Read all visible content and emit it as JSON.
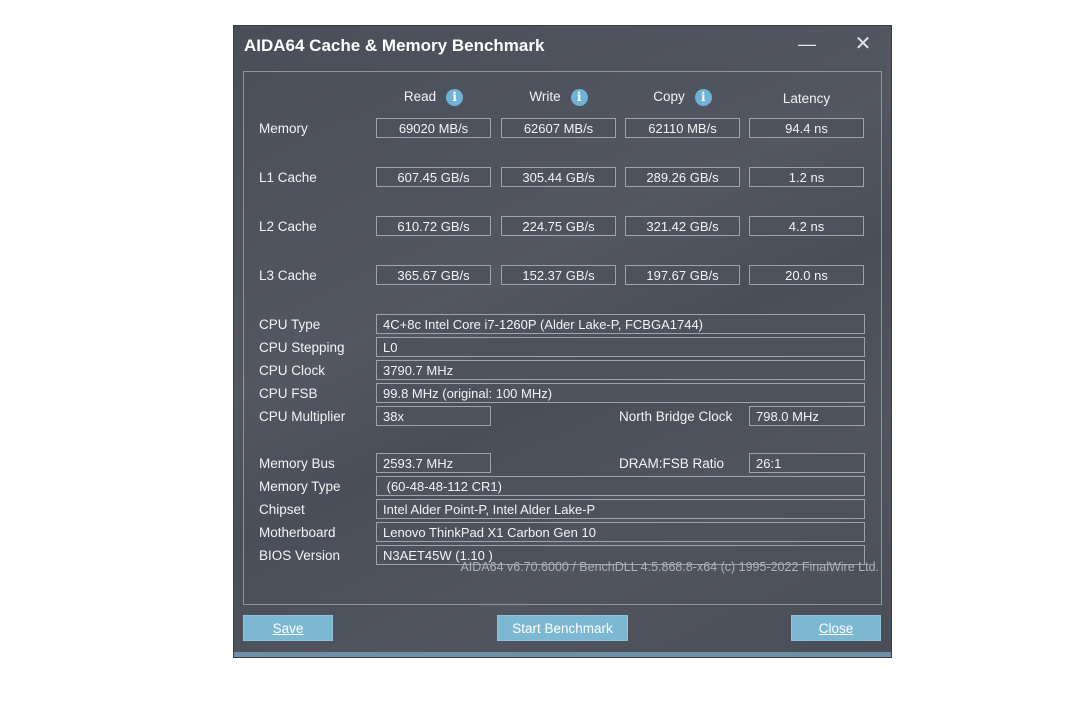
{
  "window": {
    "title": "AIDA64 Cache & Memory Benchmark",
    "minimize_glyph": "—",
    "close_glyph": "✕"
  },
  "columns": {
    "read": "Read",
    "write": "Write",
    "copy": "Copy",
    "latency": "Latency",
    "info_glyph": "i"
  },
  "bench": [
    {
      "label": "Memory",
      "read": "69020 MB/s",
      "write": "62607 MB/s",
      "copy": "62110 MB/s",
      "latency": "94.4 ns"
    },
    {
      "label": "L1 Cache",
      "read": "607.45 GB/s",
      "write": "305.44 GB/s",
      "copy": "289.26 GB/s",
      "latency": "1.2 ns"
    },
    {
      "label": "L2 Cache",
      "read": "610.72 GB/s",
      "write": "224.75 GB/s",
      "copy": "321.42 GB/s",
      "latency": "4.2 ns"
    },
    {
      "label": "L3 Cache",
      "read": "365.67 GB/s",
      "write": "152.37 GB/s",
      "copy": "197.67 GB/s",
      "latency": "20.0 ns"
    }
  ],
  "cpu": {
    "type_label": "CPU Type",
    "type_value": "4C+8c Intel Core i7-1260P  (Alder Lake-P, FCBGA1744)",
    "stepping_label": "CPU Stepping",
    "stepping_value": "L0",
    "clock_label": "CPU Clock",
    "clock_value": "3790.7 MHz",
    "fsb_label": "CPU FSB",
    "fsb_value": "99.8 MHz  (original: 100 MHz)",
    "multiplier_label": "CPU Multiplier",
    "multiplier_value": "38x",
    "nb_clock_label": "North Bridge Clock",
    "nb_clock_value": "798.0 MHz"
  },
  "memory": {
    "bus_label": "Memory Bus",
    "bus_value": "2593.7 MHz",
    "ratio_label": "DRAM:FSB Ratio",
    "ratio_value": "26:1",
    "type_label": "Memory Type",
    "type_value": " (60-48-48-112 CR1)",
    "chipset_label": "Chipset",
    "chipset_value": "Intel Alder Point-P, Intel Alder Lake-P",
    "motherboard_label": "Motherboard",
    "motherboard_value": "Lenovo ThinkPad X1 Carbon Gen 10",
    "bios_label": "BIOS Version",
    "bios_value": "N3AET45W (1.10 )"
  },
  "footer": "AIDA64 v6.70.6000 / BenchDLL 4.5.868.8-x64  (c) 1995-2022 FinalWire Ltd.",
  "buttons": {
    "save": "Save",
    "start": "Start Benchmark",
    "close": "Close"
  },
  "colors": {
    "window_bg": "#4a4e58",
    "button_bg": "#7db8d3",
    "info_icon": "#6fb3d6"
  }
}
